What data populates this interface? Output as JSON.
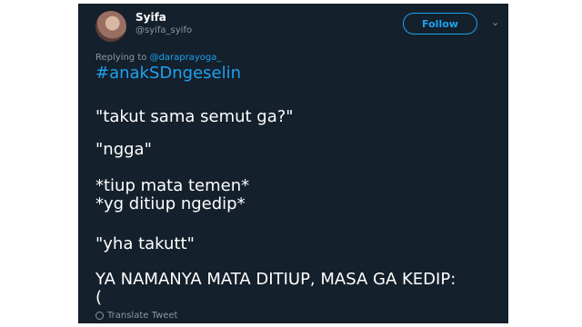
{
  "tweet": {
    "display_name": "Syifa",
    "handle": "@syifa_syifo",
    "follow_label": "Follow",
    "replying_prefix": "Replying to",
    "replying_to": "@daraprayoga_",
    "hashtag": "#anakSDngeselin",
    "lines": [
      "\"takut sama semut ga?\"",
      "\"ngga\"",
      "*tiup mata temen*",
      "*yg ditiup ngedip*",
      "\"yha takutt\"",
      "YA NAMANYA MATA DITIUP, MASA GA KEDIP:",
      "("
    ],
    "translate_label": "Translate Tweet",
    "icons": {
      "avatar": "profile-photo",
      "menu": "chevron-down-icon",
      "translate": "globe-icon"
    },
    "colors": {
      "background": "#14202b",
      "accent": "#1da1f2",
      "secondary_text": "#8899a6"
    }
  }
}
